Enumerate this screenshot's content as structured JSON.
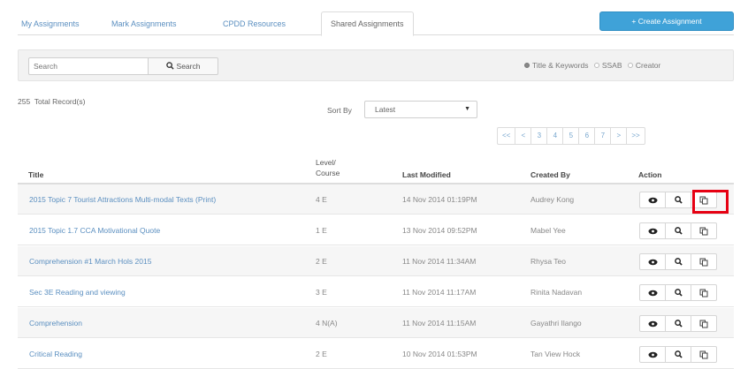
{
  "tabs": [
    {
      "label": "My Assignments",
      "active": false
    },
    {
      "label": "Mark Assignments",
      "active": false
    },
    {
      "label": "CPDD Resources",
      "active": false
    },
    {
      "label": "Shared Assignments",
      "active": true
    }
  ],
  "create_button": {
    "label": "+ Create Assignment"
  },
  "search": {
    "placeholder": "Search",
    "button_label": "Search",
    "options": [
      {
        "label": "Title & Keywords",
        "selected": true
      },
      {
        "label": "SSAB",
        "selected": false
      },
      {
        "label": "Creator",
        "selected": false
      }
    ]
  },
  "records": {
    "count": "255",
    "label": "Total Record(s)"
  },
  "sort": {
    "label": "Sort By",
    "selected": "Latest"
  },
  "pagination": [
    "<<",
    "<",
    "3",
    "4",
    "5",
    "6",
    "7",
    ">",
    ">>"
  ],
  "table": {
    "headers": {
      "title": "Title",
      "level_line1": "Level/",
      "level_line2": "Course",
      "modified": "Last Modified",
      "created_by": "Created By",
      "action": "Action"
    },
    "rows": [
      {
        "title": "2015 Topic 7 Tourist Attractions Multi-modal Texts (Print)",
        "level": "4 E",
        "modified": "14 Nov 2014 01:19PM",
        "created_by": "Audrey Kong"
      },
      {
        "title": "2015 Topic 1.7 CCA Motivational Quote",
        "level": "1 E",
        "modified": "13 Nov 2014 09:52PM",
        "created_by": "Mabel Yee"
      },
      {
        "title": "Comprehension #1 March Hols 2015",
        "level": "2 E",
        "modified": "11 Nov 2014 11:34AM",
        "created_by": "Rhysa Teo"
      },
      {
        "title": "Sec 3E Reading and viewing",
        "level": "3 E",
        "modified": "11 Nov 2014 11:17AM",
        "created_by": "Rinita Nadavan"
      },
      {
        "title": "Comprehension",
        "level": "4 N(A)",
        "modified": "11 Nov 2014 11:15AM",
        "created_by": "Gayathri Ilango"
      },
      {
        "title": "Critical Reading",
        "level": "2 E",
        "modified": "10 Nov 2014 01:53PM",
        "created_by": "Tan View Hock"
      }
    ]
  },
  "icons": {
    "view": "eye-icon",
    "preview": "magnifier-icon",
    "copy": "copy-icon",
    "search": "magnifier-icon",
    "dropdown": "caret-down-icon"
  },
  "colors": {
    "link": "#5b8fc0",
    "primary_button": "#3fa2d8",
    "highlight": "#e60012"
  }
}
